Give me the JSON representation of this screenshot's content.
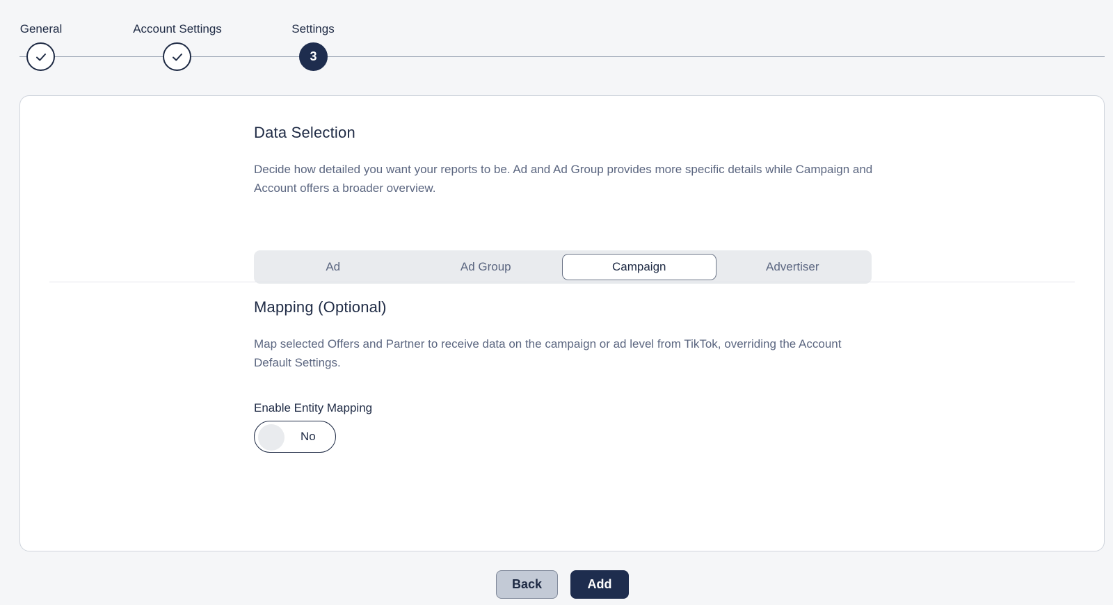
{
  "stepper": {
    "steps": [
      {
        "label": "General",
        "status": "complete"
      },
      {
        "label": "Account Settings",
        "status": "complete"
      },
      {
        "label": "Settings",
        "status": "active",
        "number": "3"
      }
    ]
  },
  "data_selection": {
    "title": "Data Selection",
    "description": "Decide how detailed you want your reports to be. Ad and Ad Group provides more specific details while Campaign and Account offers a broader overview.",
    "options": [
      {
        "label": "Ad",
        "selected": false
      },
      {
        "label": "Ad Group",
        "selected": false
      },
      {
        "label": "Campaign",
        "selected": true
      },
      {
        "label": "Advertiser",
        "selected": false
      }
    ]
  },
  "mapping": {
    "title": "Mapping (Optional)",
    "description": "Map selected Offers and Partner to receive data on the campaign or ad level from TikTok, overriding the Account Default Settings.",
    "toggle_label": "Enable Entity Mapping",
    "toggle_value": "No",
    "toggle_on": false
  },
  "actions": {
    "back_label": "Back",
    "add_label": "Add"
  },
  "colors": {
    "primary": "#1e2d4e",
    "text_muted": "#5b6680",
    "segment_bg": "#e9ebee"
  }
}
